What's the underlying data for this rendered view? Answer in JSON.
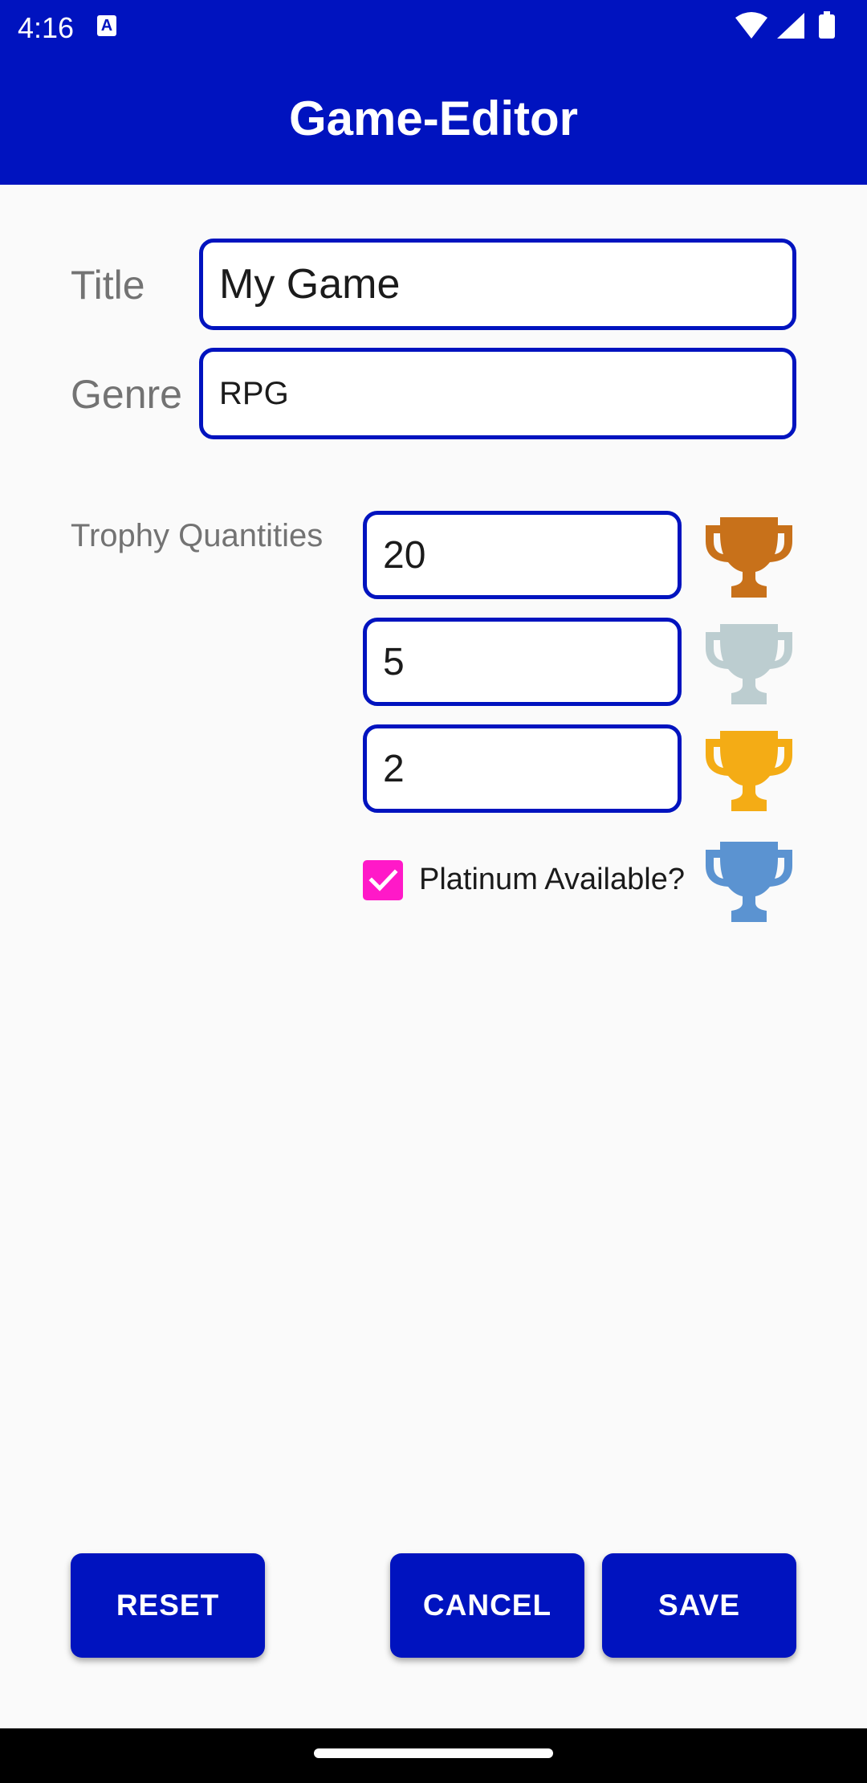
{
  "status_bar": {
    "time": "4:16",
    "notification_glyph": "A",
    "icons": [
      "wifi-icon",
      "signal-icon",
      "battery-icon"
    ]
  },
  "app_bar": {
    "title": "Game-Editor"
  },
  "form": {
    "title_label": "Title",
    "title_value": "My Game",
    "genre_label": "Genre",
    "genre_value": "RPG",
    "trophy_label": "Trophy Quantities",
    "trophies": [
      {
        "tier": "bronze",
        "value": "20",
        "color": "#c8711a",
        "icon": "bronze-trophy-icon"
      },
      {
        "tier": "silver",
        "value": "5",
        "color": "#bccdd0",
        "icon": "silver-trophy-icon"
      },
      {
        "tier": "gold",
        "value": "2",
        "color": "#f4ac15",
        "icon": "gold-trophy-icon"
      }
    ],
    "platinum": {
      "label": "Platinum Available?",
      "checked": true,
      "checkbox_color": "#ff19c8",
      "trophy_color": "#5b93d1",
      "icon": "platinum-trophy-icon"
    }
  },
  "buttons": {
    "reset": "RESET",
    "cancel": "CANCEL",
    "save": "SAVE"
  },
  "theme": {
    "primary": "#0013bf",
    "background": "#fafafa"
  }
}
